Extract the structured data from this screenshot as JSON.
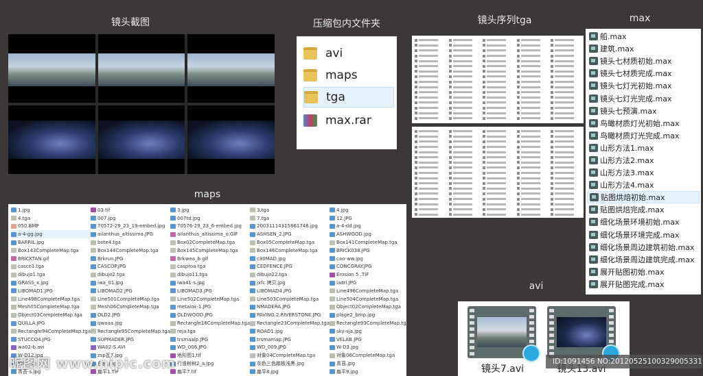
{
  "titles": {
    "screenshots": "镜头截图",
    "folder": "压缩包内文件夹",
    "tga": "镜头序列tga",
    "max": "max",
    "maps": "maps",
    "avi": "avi"
  },
  "folder_items": [
    {
      "label": "avi",
      "icon": "folder-icon"
    },
    {
      "label": "maps",
      "icon": "folder-icon"
    },
    {
      "label": "tga",
      "icon": "folder-icon",
      "selected": true
    },
    {
      "label": "max.rar",
      "icon": "rar-archive-icon"
    }
  ],
  "max_files": [
    "船.max",
    "建筑.max",
    "镜头七材质初始.max",
    "镜头七材质完成.max",
    "镜头七灯光初始.max",
    "镜头七灯光完成.max",
    "镜头七预演.max",
    "鸟瞰材质灯光初始.max",
    "鸟瞰材质灯光完成.max",
    "山形方法1.max",
    "山形方法2.max",
    "山形方法3.max",
    "山形方法4.max",
    "贴图烘焙初始.max",
    "贴图烘焙完成.max",
    "细化场景环境初始.max",
    "细化场景环境完成.max",
    "细化场景周边建筑初始.max",
    "细化场景周边建筑完成.max",
    "展开贴图初始.max",
    "展开贴图完成.max"
  ],
  "max_selected": 13,
  "maps_columns": [
    [
      "1.jpg",
      "4.tga",
      "050.BMP",
      "a-4-gg.jpg",
      "BARRIL.jpg",
      "Box143CompleteMap.tga",
      "BRICKTAN.gif",
      "casco1.tga",
      "dibujo1.tga",
      "GRASS_x.jpg",
      "LIBOMAD1.JPG",
      "Line498CompleteMap.tga",
      "Mesh05CompleteMap.tga",
      "Object03CompleteMap.tga",
      "QUILLA.JPG",
      "Rectangle94CompleteMap.tga",
      "STUCCO4.JPG",
      "wa02-b.avi",
      "W-D12.jpg",
      "树叶.jpg",
      "青苔-s.jpg"
    ],
    [
      "03.tif",
      "007.jpg",
      "70572-29_23_19-embed.jpg",
      "ailanthus_altissima.JPG",
      "bote4.tga",
      "Box144CompleteMap.tga",
      "Brkrun.JPG",
      "CASCOP.JPG",
      "dibujo2.tga",
      "iwa_01.jpg",
      "LIBOMAD2.JPG",
      "Line501CompleteMap.tga",
      "Mesh06CompleteMap.tga",
      "OLD2.JPG",
      "qwaaa.jpg",
      "Rectangle95CompleteMap.tga",
      "SUPMADER.JPG",
      "WA02-S.AVI",
      "zsp瓦7.jpg",
      "白色.jpg",
      "扁平1.TIF"
    ],
    [
      "3.jpg",
      "007td.jpg",
      "70576-29_23_6-embed.jpg",
      "ailanthus_altissima_o.GIF",
      "Box02CompleteMap.tga",
      "Box145CompleteMap.tga",
      "Brkwea_b.gif",
      "casproa.tga",
      "dibujo11.tga",
      "iwa41-s.jpg",
      "LIBOMAD3.JPG",
      "Line502CompleteMap.tga",
      "metalox-1.JPG",
      "OLDWOOD.JPG",
      "Rectangle18CompleteMap.tga",
      "reja.tga",
      "trsmaalp.JPG",
      "WD_006.JPG",
      "地形图1.tif",
      "行道树树2_a.jpg",
      "扁平7.tif"
    ],
    [
      "3.tga",
      "7.tga",
      "20031114315861746.jpg",
      "ASHSEN_2.JPG",
      "Box05CompleteMap.tga",
      "Box146CompleteMap.tga",
      "c30MAD.jpg",
      "CEDFENCE.JPG",
      "dibujo22.tga",
      "jxfc 拷贝.jpg",
      "LIBOMAD4.JPG",
      "Line503CompleteMap.tga",
      "NMADERA.JPG",
      "PAVING.2.RIVERSTONE.JPG",
      "Rectangle23CompleteMap.tga",
      "ROAD1.jpg",
      "trsmamap.JPG",
      "WD_009.JPG",
      "对象04CompleteMap.tga",
      "灰色三色踏板浅黑.jpg",
      "扁平8.jpg"
    ],
    [
      "4.jpg",
      "12.JPG",
      "a-4-dd.jpg",
      "ASHWOOD.jpg",
      "Box141CompleteMap.tga",
      "BRICK038.JPG",
      "cao-ww.jpg",
      "CONCGRAY.JPG",
      "Erosion 5 .TIF",
      "ladri.JPG",
      "Line496CompleteMap.tga",
      "Line504CompleteMap.tga",
      "Object02CompleteMap.tga",
      "plage2_bmp.jpg",
      "Rectangle93CompleteMap.tga",
      "sky-sja.jpg",
      "VELAB.JPG",
      "W-D3.jpg",
      "对象06CompleteMap.tga",
      "青苔.jpg",
      "扁平9.jpg"
    ]
  ],
  "avi_files": [
    "镜头7.avi",
    "镜头13.avi"
  ],
  "watermark": "昵图网 www.nipic.com",
  "image_id": "ID:1091456 NO:20120525100329005331"
}
